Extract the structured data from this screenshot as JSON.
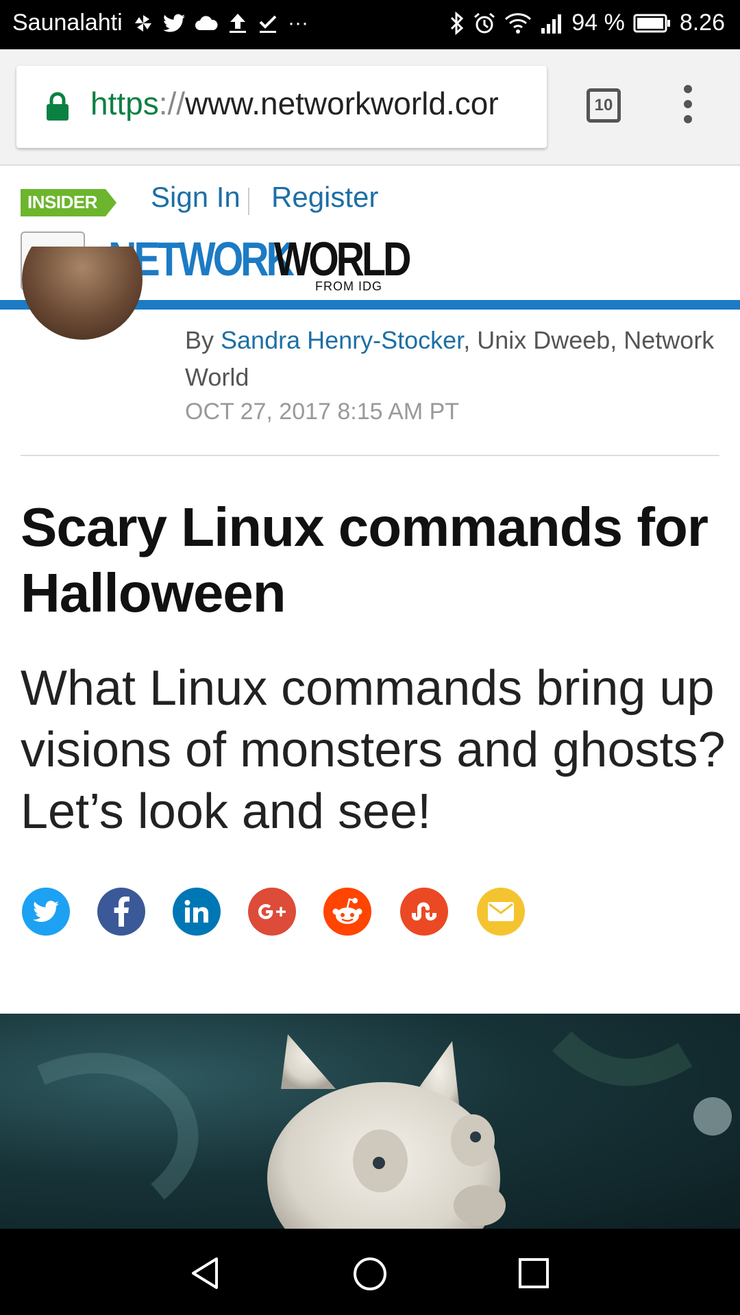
{
  "status_bar": {
    "carrier": "Saunalahti",
    "more": "···",
    "battery_percent": "94 %",
    "time": "8.26"
  },
  "browser": {
    "url_scheme": "https",
    "url_sep": "://",
    "url_rest": "www.networkworld.cor",
    "tab_count": "10"
  },
  "site": {
    "insider_label": "INSIDER",
    "sign_in": "Sign In",
    "divider": "|",
    "register": "Register",
    "logo_network": "NETWORK",
    "logo_world": "WORLD",
    "logo_from": "FROM IDG"
  },
  "article": {
    "by": "By ",
    "author": "Sandra Henry-Stocker",
    "author_suffix": ", Unix Dweeb, Network World",
    "date": "OCT 27, 2017 8:15 AM PT",
    "title": "Scary Linux commands for Halloween",
    "dek": "What Linux commands bring up visions of monsters and ghosts? Let’s look and see!"
  },
  "share_buttons": [
    {
      "name": "twitter",
      "color": "#1da1f2"
    },
    {
      "name": "facebook",
      "color": "#3b5998"
    },
    {
      "name": "linkedin",
      "color": "#0077b5"
    },
    {
      "name": "google-plus",
      "color": "#dd4b39"
    },
    {
      "name": "reddit",
      "color": "#ff4500"
    },
    {
      "name": "stumbleupon",
      "color": "#eb4924"
    },
    {
      "name": "email",
      "color": "#f4c430"
    }
  ],
  "colors": {
    "link_blue": "#1c6fa6",
    "rule_blue": "#1c7bc4",
    "insider_green": "#6cb52d",
    "url_green": "#0b8043"
  }
}
